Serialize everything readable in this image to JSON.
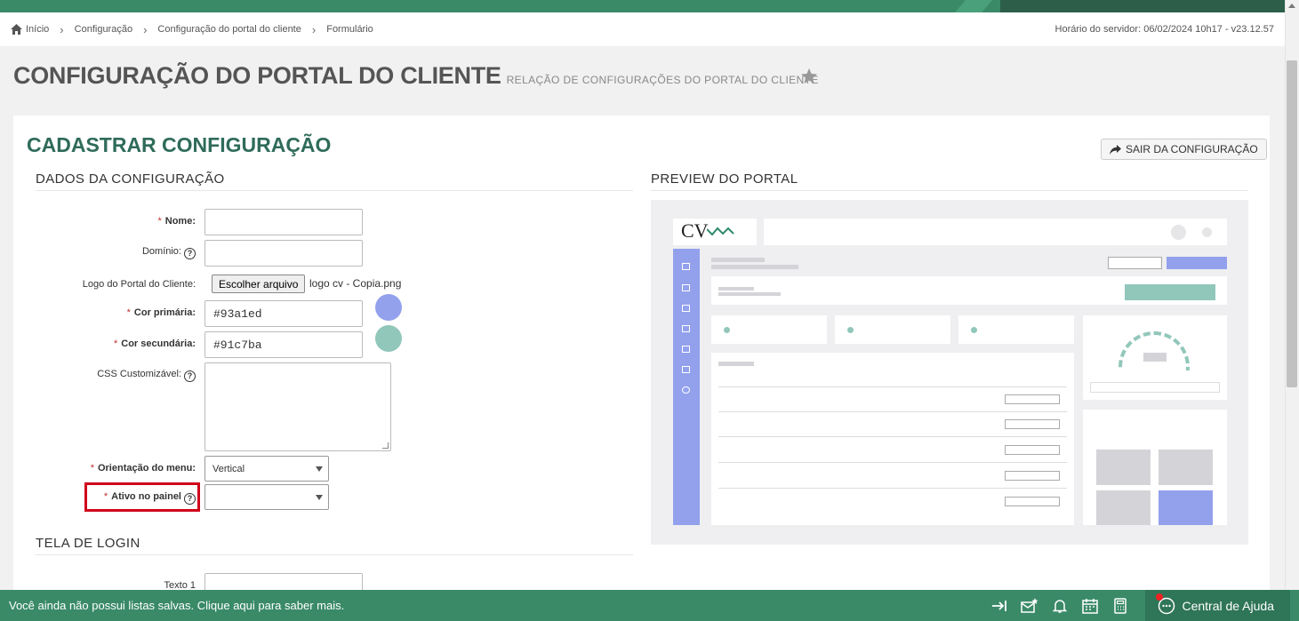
{
  "breadcrumb": {
    "items": [
      "Início",
      "Configuração",
      "Configuração do portal do cliente",
      "Formulário"
    ]
  },
  "server_time": "Horário do servidor: 06/02/2024 10h17 - v23.12.57",
  "page": {
    "title": "CONFIGURAÇÃO DO PORTAL DO CLIENTE",
    "subtitle": "RELAÇÃO DE CONFIGURAÇÕES DO PORTAL DO CLIENTE"
  },
  "panel": {
    "title": "CADASTRAR CONFIGURAÇÃO",
    "exit_button": "SAIR DA CONFIGURAÇÃO"
  },
  "sections": {
    "config_data": "DADOS DA CONFIGURAÇÃO",
    "preview": "PREVIEW DO PORTAL",
    "login_screen": "TELA DE LOGIN"
  },
  "form": {
    "nome_label": "Nome:",
    "nome_value": "",
    "dominio_label": "Domínio:",
    "dominio_value": "",
    "logo_label": "Logo do Portal do Cliente:",
    "logo_button": "Escolher arquivo",
    "logo_file": "logo cv - Copia.png",
    "cor_primaria_label": "Cor primária:",
    "cor_primaria_value": "#93a1ed",
    "cor_secundaria_label": "Cor secundária:",
    "cor_secundaria_value": "#91c7ba",
    "css_label": "CSS Customizável:",
    "orientacao_label": "Orientação do menu:",
    "orientacao_value": "Vertical",
    "ativo_label": "Ativo no painel",
    "ativo_value": "",
    "texto1_label": "Texto 1",
    "required_mark": "*",
    "help_mark": "?"
  },
  "preview_logo_text": "CV",
  "colors": {
    "primary": "#93a1ed",
    "secondary": "#91c7ba",
    "brand_green": "#3a8a68",
    "heading_green": "#2f6b5a",
    "highlight": "#d0021b"
  },
  "footer": {
    "message": "Você ainda não possui listas salvas. Clique aqui para saber mais.",
    "icons": [
      "collapse-right-icon",
      "mail-star-icon",
      "bell-icon",
      "calendar-icon",
      "calculator-icon"
    ],
    "help_center": "Central de Ajuda"
  }
}
